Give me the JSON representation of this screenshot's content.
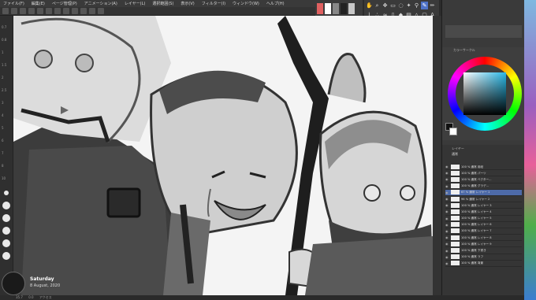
{
  "menu": {
    "items": [
      "ファイル(F)",
      "編集(E)",
      "ページ管理(P)",
      "アニメーション(A)",
      "レイヤー(L)",
      "選択範囲(S)",
      "表示(V)",
      "フィルター(I)",
      "ウィンドウ(W)",
      "ヘルプ(H)"
    ]
  },
  "tools": {
    "icons": [
      "hand-icon",
      "zoom-icon",
      "move-icon",
      "select-icon",
      "lasso-icon",
      "wand-icon",
      "eyedropper-icon",
      "pen-icon",
      "pencil-icon",
      "brush-icon",
      "airbrush-icon",
      "blend-icon",
      "eraser-icon",
      "fill-icon",
      "gradient-icon",
      "figure-icon",
      "frame-icon",
      "text-icon"
    ]
  },
  "colors": {
    "accent": "#4f73c8",
    "swatch1": "#e06060",
    "swatch2": "#ffffff",
    "swatch3": "#888888",
    "swatch4": "#222222",
    "swatch5": "#c8c8c8"
  },
  "ruler": {
    "ticks": [
      "0.7",
      "0.8",
      "1",
      "1.5",
      "2",
      "2.5",
      "3",
      "4",
      "5",
      "6",
      "7",
      "8",
      "10",
      "12",
      "15",
      "17",
      "20",
      "25",
      "30",
      "40",
      "50"
    ]
  },
  "colorpanel": {
    "title": "カラーサークル",
    "current_hue": "#29b7e6"
  },
  "layers": {
    "title": "レイヤー",
    "blend": "通常",
    "opacity": "100",
    "items": [
      {
        "name": "100 % 通常 用紙",
        "selected": false
      },
      {
        "name": "100 % 通常 パーツ",
        "selected": false
      },
      {
        "name": "100 % 通常 ベクター...",
        "selected": false
      },
      {
        "name": "100 % 通常 グラデ...",
        "selected": false
      },
      {
        "name": "67 % 通常 レイヤー 1",
        "selected": true
      },
      {
        "name": "96 % 通常 レイヤー 2",
        "selected": false
      },
      {
        "name": "100 % 通常 レイヤー 3",
        "selected": false
      },
      {
        "name": "100 % 通常 レイヤー 4",
        "selected": false
      },
      {
        "name": "100 % 通常 レイヤー 5",
        "selected": false
      },
      {
        "name": "100 % 通常 レイヤー 6",
        "selected": false
      },
      {
        "name": "100 % 通常 レイヤー 7",
        "selected": false
      },
      {
        "name": "100 % 通常 レイヤー 8",
        "selected": false
      },
      {
        "name": "100 % 通常 レイヤー 9",
        "selected": false
      },
      {
        "name": "100 % 通常 下書き",
        "selected": false
      },
      {
        "name": "100 % 通常 ラフ",
        "selected": false
      },
      {
        "name": "100 % 通常 背景",
        "selected": false
      }
    ]
  },
  "status": {
    "zoom": "35.7",
    "coords": "0.0",
    "label": "アクセス"
  },
  "clock": {
    "day": "Saturday",
    "date": "8 August, 2020"
  }
}
